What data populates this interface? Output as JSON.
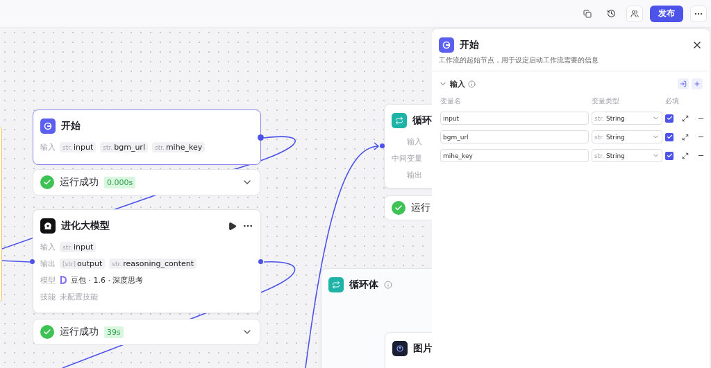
{
  "toolbar": {
    "publish": "发布"
  },
  "nodes": [
    {
      "kind": "start",
      "title": "开始",
      "rows": [
        {
          "kind": "tags",
          "label": "输入",
          "tags": [
            {
              "type": "str.",
              "name": "input"
            },
            {
              "type": "str.",
              "name": "bgm_url"
            },
            {
              "type": "str.",
              "name": "mihe_key"
            }
          ]
        }
      ],
      "status": {
        "text": "运行成功",
        "time": "0.000s"
      }
    },
    {
      "kind": "llm",
      "title": "进化大模型",
      "rows": [
        {
          "kind": "tags",
          "label": "输入",
          "tags": [
            {
              "type": "str.",
              "name": "input"
            }
          ]
        },
        {
          "kind": "tags",
          "label": "输出",
          "tags": [
            {
              "type": "[str]",
              "name": "output"
            },
            {
              "type": "str.",
              "name": "reasoning_content"
            }
          ]
        },
        {
          "kind": "model",
          "label": "模型",
          "value": "豆包 · 1.6 · 深度思考"
        },
        {
          "kind": "empty",
          "label": "技能",
          "value": "未配置技能"
        }
      ],
      "status": {
        "text": "运行成功",
        "time": "39s"
      }
    },
    {
      "kind": "loop",
      "title": "循环",
      "rows": [
        {
          "kind": "label",
          "label": "输入"
        },
        {
          "kind": "label",
          "label": "中间变量"
        },
        {
          "kind": "label",
          "label": "输出"
        }
      ],
      "status": {
        "text": "运行"
      }
    },
    {
      "kind": "loop-body",
      "title": "循环体",
      "inner": {
        "title": "图片"
      }
    }
  ],
  "panel": {
    "title": "开始",
    "description": "工作流的起始节点，用于设定启动工作流需要的信息",
    "section": "输入",
    "columns": [
      "变量名",
      "变量类型",
      "必填"
    ],
    "rows": [
      {
        "name": "input",
        "type_prefix": "str.",
        "type": "String",
        "checked": true
      },
      {
        "name": "bgm_url",
        "type_prefix": "str.",
        "type": "String",
        "checked": true
      },
      {
        "name": "mihe_key",
        "type_prefix": "str.",
        "type": "String",
        "checked": true
      }
    ]
  }
}
